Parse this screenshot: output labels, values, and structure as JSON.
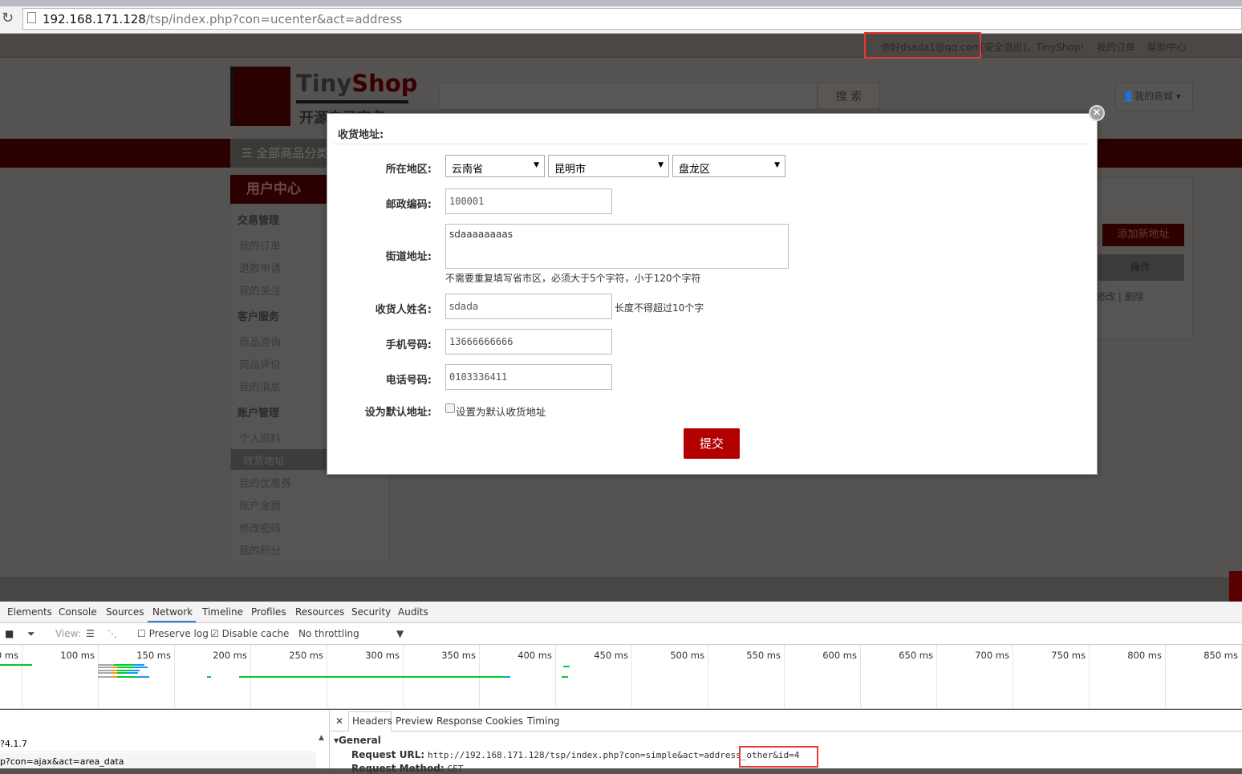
{
  "browser": {
    "url_host": "192.168.171.128",
    "url_path": "/tsp/index.php?con=ucenter&act=address"
  },
  "topbar": {
    "greeting": "你好dsada1@qq.com",
    "logout": "[安全退出]，TinyShop!",
    "my_orders": "我的订单",
    "help": "帮助中心"
  },
  "header": {
    "logo_main": "Tiny",
    "logo_accent": "Shop",
    "logo_sub": "开源电子商务",
    "search_button": "搜 索",
    "my_mall": "我的商城"
  },
  "nav": {
    "all_categories": "全部商品分类"
  },
  "sidebar": {
    "title": "用户中心",
    "groups": [
      {
        "label": "交易管理",
        "items": [
          "我的订单",
          "退款申请",
          "我的关注"
        ]
      },
      {
        "label": "客户服务",
        "items": [
          "商品咨询",
          "商品评价",
          "我的消息"
        ]
      },
      {
        "label": "账户管理",
        "items": [
          "个人资料",
          "收货地址",
          "我的优惠券",
          "账户金额",
          "修改密码",
          "我的积分"
        ]
      }
    ],
    "selected": "收货地址"
  },
  "right_panel": {
    "add_address": "添加新地址",
    "op_header": "操作",
    "op_links": "修改 | 删除"
  },
  "modal": {
    "title": "收货地址:",
    "region_label": "所在地区:",
    "province": "云南省",
    "city": "昆明市",
    "district": "盘龙区",
    "zip_label": "邮政编码:",
    "zip": "100001",
    "street_label": "街道地址:",
    "street": "sdaaaaaaaas",
    "street_hint": "不需要重复填写省市区，必须大于5个字符，小于120个字符",
    "name_label": "收货人姓名:",
    "name": "sdada",
    "name_hint": "长度不得超过10个字",
    "mobile_label": "手机号码:",
    "mobile": "13666666666",
    "phone_label": "电话号码:",
    "phone": "0103336411",
    "default_label": "设为默认地址:",
    "default_checkbox": "设置为默认收货地址",
    "default_checked": false,
    "submit": "提交",
    "close": "×"
  },
  "devtools": {
    "tabs": [
      "Elements",
      "Console",
      "Sources",
      "Network",
      "Timeline",
      "Profiles",
      "Resources",
      "Security",
      "Audits"
    ],
    "active_tab": "Network",
    "toolbar": {
      "view": "View:",
      "preserve_log": "Preserve log",
      "preserve_checked": false,
      "disable_cache": "Disable cache",
      "disable_checked": true,
      "throttling": "No throttling"
    },
    "timeline_ticks": [
      "0 ms",
      "100 ms",
      "150 ms",
      "200 ms",
      "250 ms",
      "300 ms",
      "350 ms",
      "400 ms",
      "450 ms",
      "500 ms",
      "550 ms",
      "600 ms",
      "650 ms",
      "700 ms",
      "750 ms",
      "800 ms",
      "850 ms"
    ],
    "requests": [
      "?4.1.7",
      "p?con=ajax&act=area_data"
    ],
    "detail_tabs": [
      "Headers",
      "Preview",
      "Response",
      "Cookies",
      "Timing"
    ],
    "general": "General",
    "request_url_label": "Request URL:",
    "request_url": "http://192.168.171.128/tsp/index.php?con=simple&act=address_other&id=4",
    "request_method_label": "Request Method:",
    "request_method": "GET"
  },
  "colors": {
    "accent_red": "#b30000",
    "devtools_blue": "#3879d9",
    "highlight_box": "#e53935"
  }
}
